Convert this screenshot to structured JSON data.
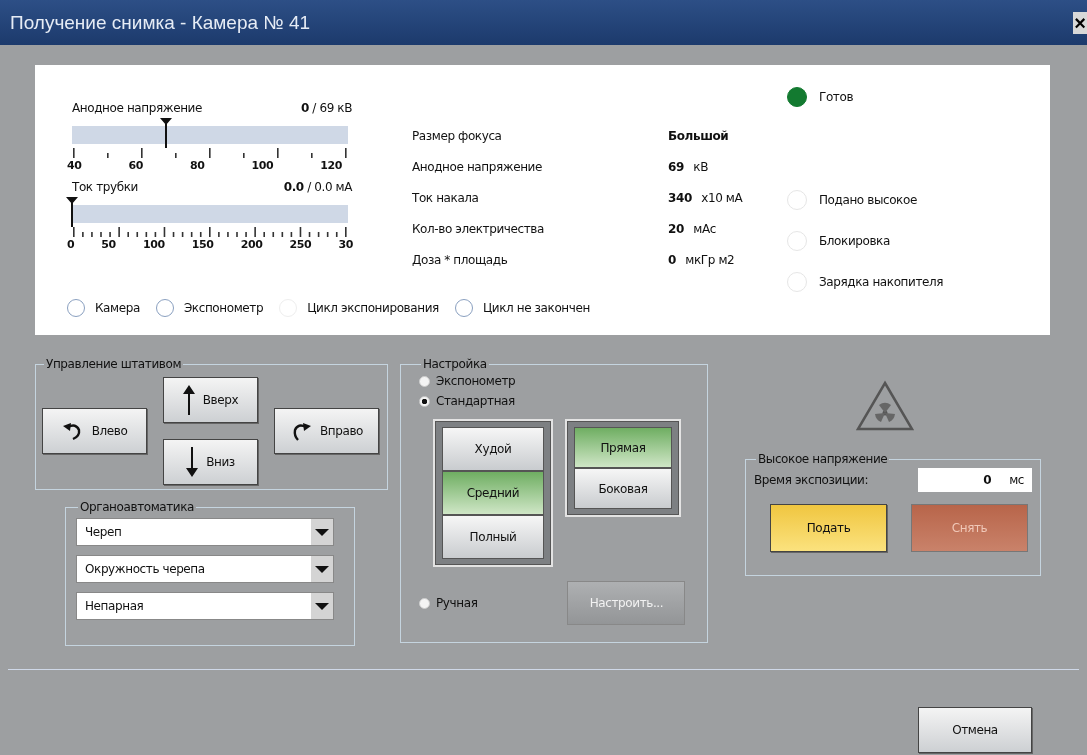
{
  "window": {
    "title": "Получение снимка - Камера № 41",
    "close": "×"
  },
  "sliders": [
    {
      "label": "Анодное напряжение",
      "reading_value": "0",
      "reading_rest": "/ 69 кВ",
      "level": 0.34,
      "ticks": [
        "40",
        "60",
        "80",
        "100",
        "120"
      ]
    },
    {
      "label": "Ток трубки",
      "reading_value": "0.0",
      "reading_rest": "/ 0.0 мА",
      "level": 0,
      "ticks": [
        "0",
        "50",
        "100",
        "150",
        "200",
        "250",
        "30"
      ]
    }
  ],
  "cycle_indicators": [
    {
      "label": "Камера",
      "dimmed": false
    },
    {
      "label": "Экспонометр",
      "dimmed": false
    },
    {
      "label": "Цикл экспонирования",
      "dimmed": true
    },
    {
      "label": "Цикл не закончен",
      "dimmed": false
    }
  ],
  "info_rows": [
    {
      "label": "Размер фокуса",
      "value": "Большой"
    },
    {
      "label": "Анодное напряжение",
      "value": "69",
      "unit": "кВ"
    },
    {
      "label": "Ток накала",
      "value": "340",
      "unit": "x10 мА"
    },
    {
      "label": "Кол-во электричества",
      "value": "20",
      "unit": "мАс"
    },
    {
      "label": "Доза * площадь",
      "value": "0",
      "unit": "мкГр м2"
    }
  ],
  "status_indicators": [
    {
      "label": "Готов",
      "on": true
    },
    {
      "label": "Подано высокое",
      "on": false
    },
    {
      "label": "Блокировка",
      "on": false
    },
    {
      "label": "Зарядка накопителя",
      "on": false
    }
  ],
  "stand_control": {
    "title": "Управление штативом",
    "buttons": [
      {
        "label": "Влево",
        "kind": "left"
      },
      {
        "label": "Вверх",
        "kind": "up"
      },
      {
        "label": "Вниз",
        "kind": "down"
      },
      {
        "label": "Вправо",
        "kind": "right"
      }
    ]
  },
  "organ_automatics": {
    "title": "Органоавтоматика",
    "dropdowns": [
      "Череп",
      "Окружность черепа",
      "Непарная"
    ]
  },
  "setup": {
    "title": "Настройка",
    "modes": [
      {
        "label": "Экспонометр",
        "selected": false
      },
      {
        "label": "Стандартная",
        "selected": true
      },
      {
        "label": "Ручная",
        "selected": false
      }
    ],
    "build": [
      {
        "label": "Худой",
        "selected": false
      },
      {
        "label": "Средний",
        "selected": true
      },
      {
        "label": "Полный",
        "selected": false
      }
    ],
    "projection": [
      {
        "label": "Прямая",
        "selected": true
      },
      {
        "label": "Боковая",
        "selected": false
      }
    ],
    "configure": {
      "label": "Настроить...",
      "disabled": true
    }
  },
  "high_voltage": {
    "title": "Высокое напряжение",
    "exposure_label": "Время экспозиции:",
    "exposure_value": "0",
    "exposure_unit": "мс",
    "apply": {
      "label": "Подать",
      "disabled": false
    },
    "remove": {
      "label": "Снять",
      "disabled": true
    }
  },
  "footer": {
    "cancel": "Отмена"
  }
}
